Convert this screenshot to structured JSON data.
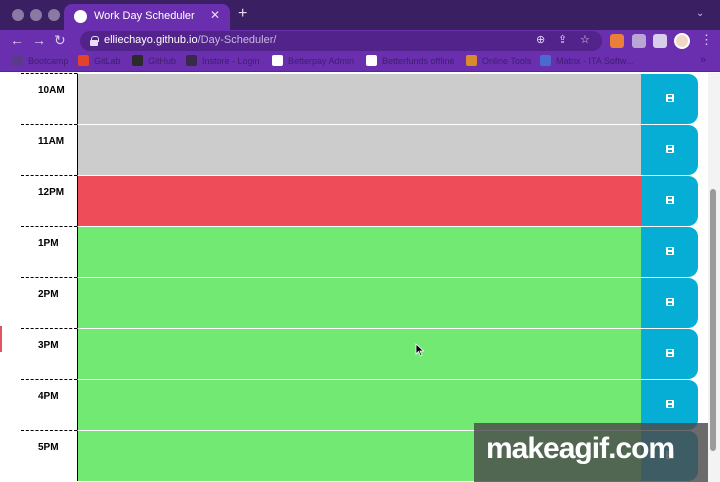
{
  "browser": {
    "tab_title": "Work Day Scheduler",
    "tab_close": "✕",
    "new_tab": "+",
    "tab_menu": "⌄",
    "url_host": "elliechayo.github.io",
    "url_path": "/Day-Scheduler/",
    "nav": {
      "back": "←",
      "forward": "→",
      "reload": "↻"
    },
    "omnibox_icons": {
      "zoom": "⊕",
      "share": "⇪",
      "star": "☆"
    },
    "kebab": "⋮",
    "bookmarks": [
      {
        "label": "Bootcamp",
        "color": "#5a3a8a"
      },
      {
        "label": "GitLab",
        "color": "#e2432a"
      },
      {
        "label": "GitHub",
        "color": "#2b2b2b"
      },
      {
        "label": "Instore - Login",
        "color": "#3a2a4a"
      },
      {
        "label": "Betterpay Admin",
        "color": "#ffffff"
      },
      {
        "label": "Betterfunds offline",
        "color": "#ffffff"
      },
      {
        "label": "Online Tools",
        "color": "#d98a2a"
      },
      {
        "label": "Matrix - ITA Softw...",
        "color": "#4a6ad0"
      }
    ],
    "bookmarks_more": "»"
  },
  "scheduler": {
    "save_icon": "floppy-disk-icon",
    "rows": [
      {
        "hour": "10AM",
        "status": "past"
      },
      {
        "hour": "11AM",
        "status": "past"
      },
      {
        "hour": "12PM",
        "status": "present"
      },
      {
        "hour": "1PM",
        "status": "future"
      },
      {
        "hour": "2PM",
        "status": "future"
      },
      {
        "hour": "3PM",
        "status": "future"
      },
      {
        "hour": "4PM",
        "status": "future"
      },
      {
        "hour": "5PM",
        "status": "future"
      }
    ]
  },
  "colors": {
    "past": "#cccccc",
    "present": "#ef4c5a",
    "future": "#72e972",
    "save_button": "#06aed5",
    "chrome_purple": "#6a2fae"
  },
  "watermark": {
    "text": "makeagif.com"
  }
}
